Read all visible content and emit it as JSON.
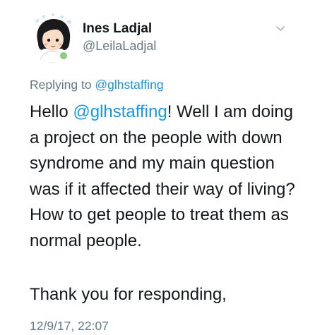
{
  "author": {
    "display_name": "Ines Ladjal",
    "handle": "@LeilaLadjal"
  },
  "menu_icon": "chevron-down-icon",
  "reply_context": {
    "prefix": "Replying to ",
    "mention": "@glhstaffing"
  },
  "tweet": {
    "greeting": "Hello ",
    "mention": "@glhstaffing",
    "body": "! Well I am doing a project on the people with down syndrome and my main question was if it affected their way of living? How to get people to treat them as normal people.",
    "closing": "Thank you for responding,"
  },
  "timestamp": "12/9/17, 22:07",
  "colors": {
    "link": "#1b95e0",
    "secondary_text": "#657786",
    "primary_text": "#14171a"
  }
}
